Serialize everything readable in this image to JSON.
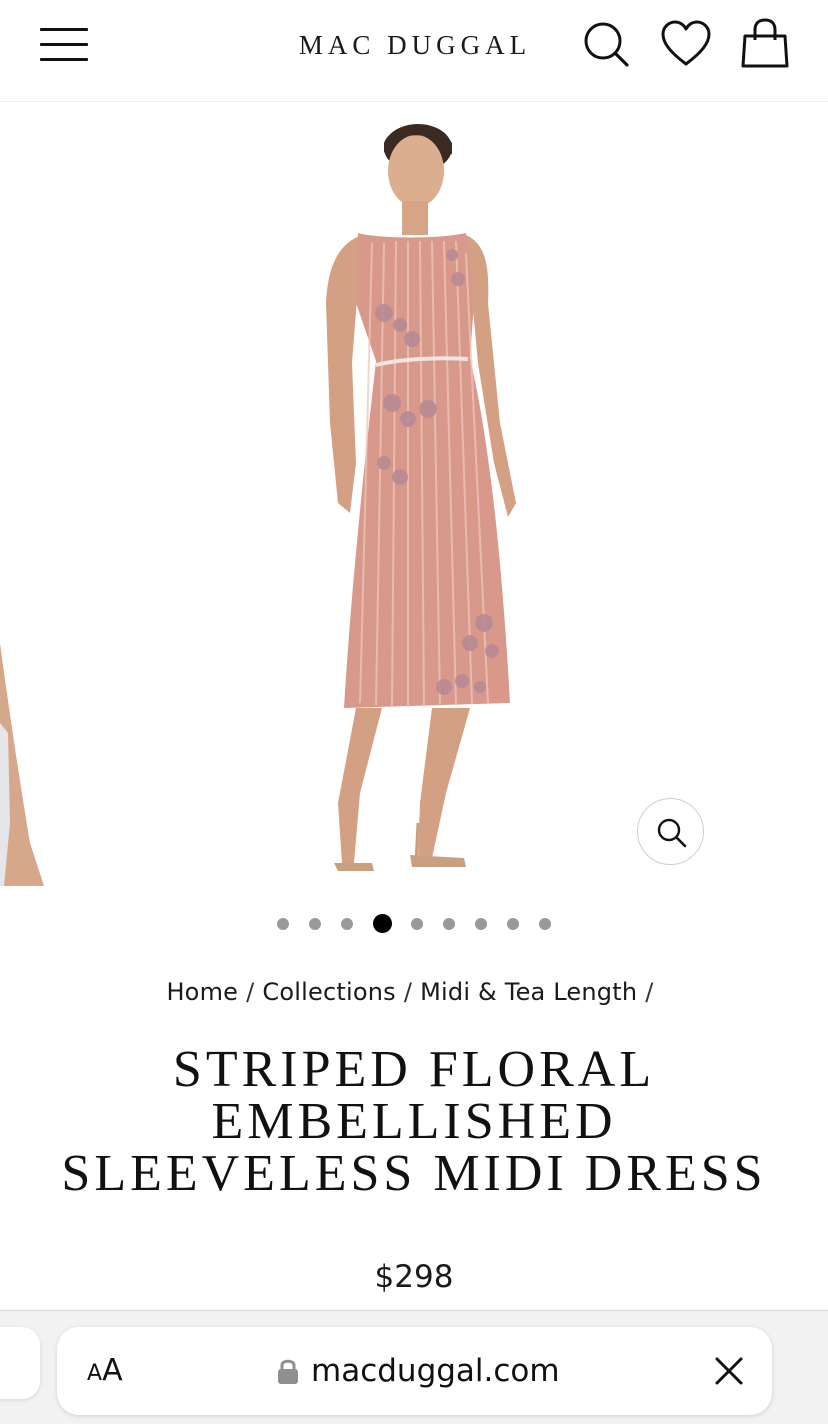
{
  "header": {
    "brand": "MAC DUGGAL",
    "icons": [
      "menu-icon",
      "search-icon",
      "heart-icon",
      "bag-icon"
    ]
  },
  "gallery": {
    "dot_count": 9,
    "active_index": 3,
    "colors": {
      "dress": "#d9998a",
      "embroidery": "#b88a95",
      "skin": "#d8a98a",
      "hair": "#3b2a22"
    },
    "zoom_icon": "zoom-icon"
  },
  "breadcrumb": {
    "items": [
      "Home",
      "Collections",
      "Midi & Tea Length"
    ],
    "separator": "/"
  },
  "product": {
    "title_lines": [
      "STRIPED FLORAL",
      "EMBELLISHED",
      "SLEEVELESS MIDI DRESS"
    ],
    "price": "$298"
  },
  "browser": {
    "aa_small": "A",
    "aa_big": "A",
    "url": "macduggal.com",
    "icons": [
      "lock-icon",
      "close-icon"
    ]
  }
}
